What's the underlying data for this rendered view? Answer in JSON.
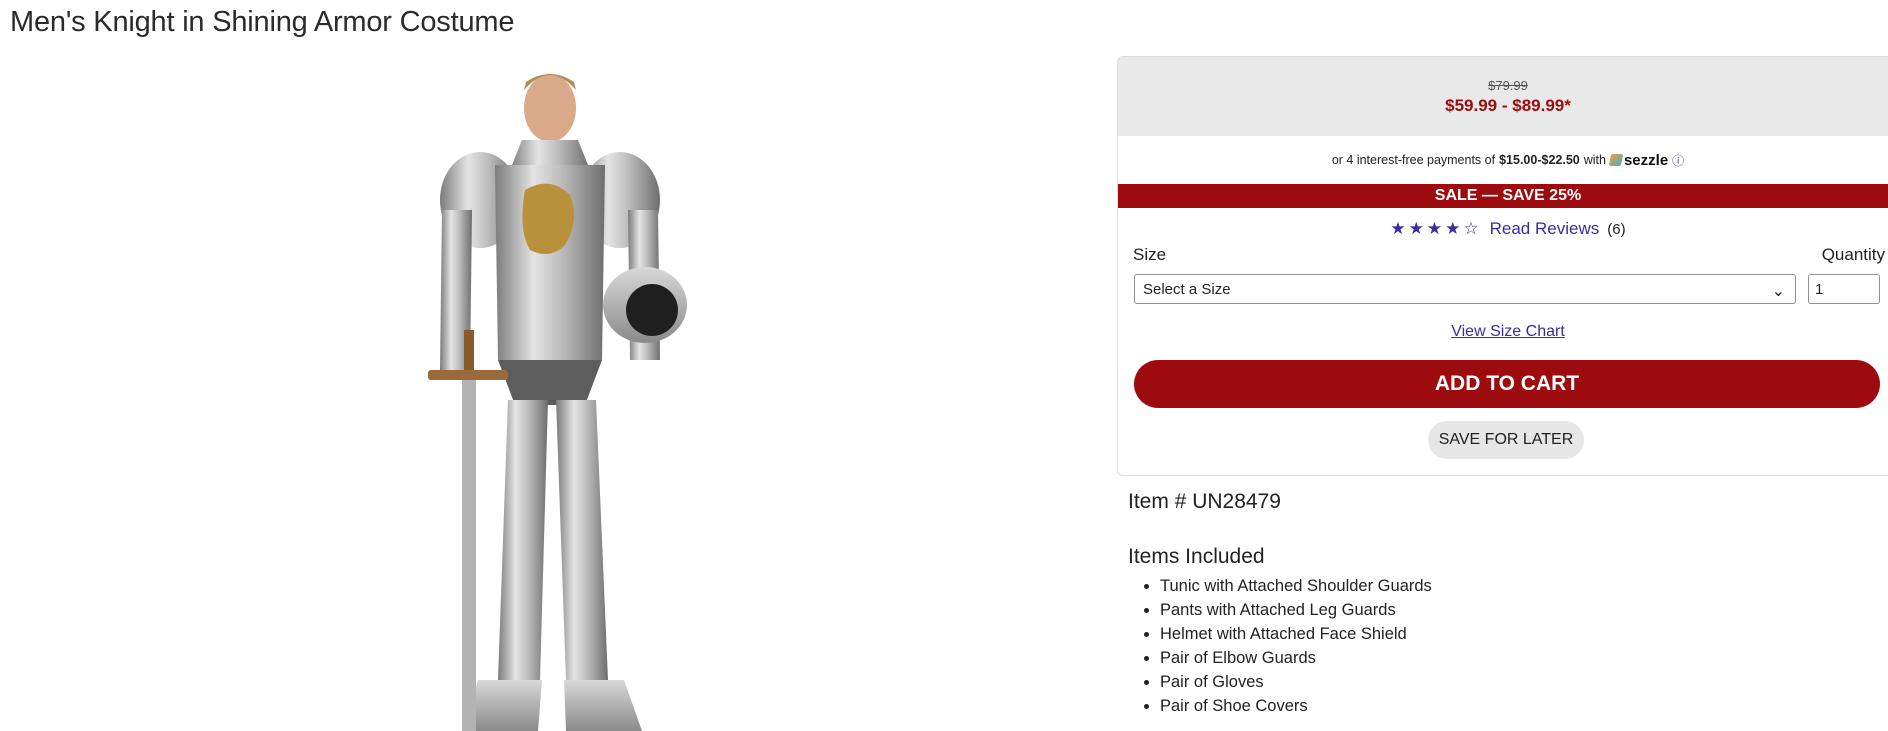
{
  "product": {
    "title": "Men's Knight in Shining Armor Costume"
  },
  "image": {
    "alt": "Men's Knight in Shining Armor Costume"
  },
  "pricing": {
    "original": "$79.99",
    "sale": "$59.99 - $89.99*",
    "installments_prefix": "or 4 interest-free payments of",
    "installments_amount": "$15.00-$22.50",
    "installments_with": "with",
    "provider": "sezzle",
    "sale_banner": "SALE — SAVE 25%"
  },
  "reviews": {
    "rating": 4,
    "max": 5,
    "link_label": "Read Reviews",
    "count": "(6)"
  },
  "form": {
    "size_label": "Size",
    "size_selected": "Select a Size",
    "quantity_label": "Quantity",
    "quantity_value": "1",
    "size_chart_link": "View Size Chart",
    "add_to_cart": "ADD TO CART",
    "save_for_later": "SAVE FOR LATER"
  },
  "details": {
    "item_number": "Item # UN28479",
    "items_heading": "Items Included",
    "items": [
      "Tunic with Attached Shoulder Guards",
      "Pants with Attached Leg Guards",
      "Helmet with Attached Face Shield",
      "Pair of Elbow Guards",
      "Pair of Gloves",
      "Pair of Shoe Covers"
    ]
  },
  "colors": {
    "brand_red": "#9e0b0f",
    "link_purple": "#3d2b9e"
  }
}
